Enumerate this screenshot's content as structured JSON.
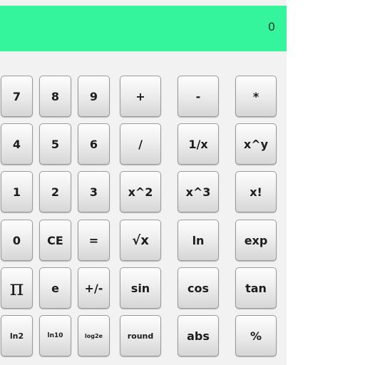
{
  "display": {
    "value": "0"
  },
  "keys": {
    "k7": "7",
    "k8": "8",
    "k9": "9",
    "plus": "+",
    "minus": "-",
    "multiply": "*",
    "k4": "4",
    "k5": "5",
    "k6": "6",
    "divide": "/",
    "reciprocal": "1/x",
    "power": "x^y",
    "k1": "1",
    "k2": "2",
    "k3": "3",
    "square": "x^2",
    "cube": "x^3",
    "factorial": "x!",
    "k0": "0",
    "ce": "CE",
    "equals": "=",
    "sqrt": "√x",
    "ln": "ln",
    "exp": "exp",
    "pi": "π",
    "e": "e",
    "sign": "+/-",
    "sin": "sin",
    "cos": "cos",
    "tan": "tan",
    "ln2": "ln2",
    "ln10": "ln10",
    "log2e": "log2e",
    "round": "round",
    "abs": "abs",
    "percent": "%"
  },
  "colors": {
    "display_bg": "#34f59c",
    "panel_bg": "#f2f2f2"
  }
}
